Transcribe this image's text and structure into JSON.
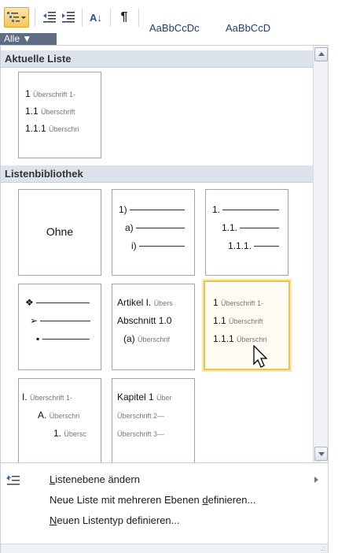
{
  "ribbon": {
    "multilevel_icon": "multilevel-list-icon",
    "buttons": [
      "decrease-indent-icon",
      "increase-indent-icon",
      "sort-icon",
      "pilcrow-icon"
    ],
    "sort_glyph": "A↓",
    "pilcrow_glyph": "¶",
    "style_samples": [
      "AaBbCcDc",
      "AaBbCcD"
    ]
  },
  "filter": {
    "label": "Alle ▼"
  },
  "sections": {
    "current": "Aktuelle Liste",
    "library": "Listenbibliothek"
  },
  "current_list": {
    "lines": [
      {
        "num": "1",
        "text": "Überschrift 1-"
      },
      {
        "num": "1.1",
        "text": "Überschrift"
      },
      {
        "num": "1.1.1",
        "text": "Überschri"
      }
    ]
  },
  "library": {
    "none_label": "Ohne",
    "paren_list": [
      "1)",
      "a)",
      "i)"
    ],
    "decimal_list": [
      "1.",
      "1.1.",
      "1.1.1."
    ],
    "article": [
      {
        "num": "Artikel I.",
        "text": "Übers"
      },
      {
        "num": "Abschnitt 1.0",
        "text": ""
      },
      {
        "num": "(a)",
        "text": "Überschrif"
      }
    ],
    "heading_selected": [
      {
        "num": "1",
        "text": "Überschrift 1-"
      },
      {
        "num": "1.1",
        "text": "Überschrift"
      },
      {
        "num": "1.1.1",
        "text": "Überschri"
      }
    ],
    "roman": [
      {
        "num": "I.",
        "text": "Überschrift 1-"
      },
      {
        "num": "A.",
        "text": "Überschri"
      },
      {
        "num": "1.",
        "text": "Übersc"
      }
    ],
    "chapter": [
      {
        "num": "Kapitel 1",
        "text": "Über"
      },
      {
        "num": "",
        "text": "Überschrift 2—"
      },
      {
        "num": "",
        "text": "Überschrift 3—"
      }
    ]
  },
  "menu": {
    "change_level": {
      "pre": "",
      "accel": "L",
      "post": "istenebene ändern"
    },
    "define_multilevel": {
      "pre": "Neue Liste mit mehreren Ebenen ",
      "accel": "d",
      "post": "efinieren..."
    },
    "define_style": {
      "pre": "",
      "accel": "N",
      "post": "euen Listentyp definieren..."
    }
  },
  "colors": {
    "selected_border": "#e8c25a",
    "section_header": "#dde3eb",
    "filter_tab": "#5f6d82"
  }
}
